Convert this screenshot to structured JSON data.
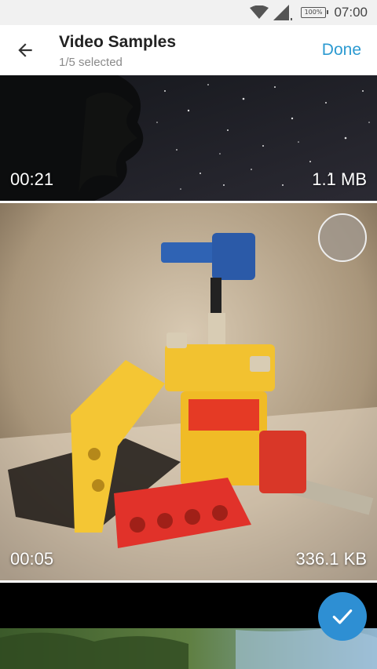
{
  "status_bar": {
    "battery": "100%",
    "time": "07:00"
  },
  "app_bar": {
    "title": "Video Samples",
    "subtitle": "1/5 selected",
    "done_label": "Done",
    "accent_color": "#2c9ad1"
  },
  "videos": [
    {
      "duration": "00:21",
      "size": "1.1 MB",
      "selected": false,
      "thumbnail": "night-sky-stars"
    },
    {
      "duration": "00:05",
      "size": "336.1 KB",
      "selected": false,
      "thumbnail": "lego-robot"
    },
    {
      "duration": "",
      "size": "",
      "selected": true,
      "thumbnail": "green-forest"
    }
  ]
}
